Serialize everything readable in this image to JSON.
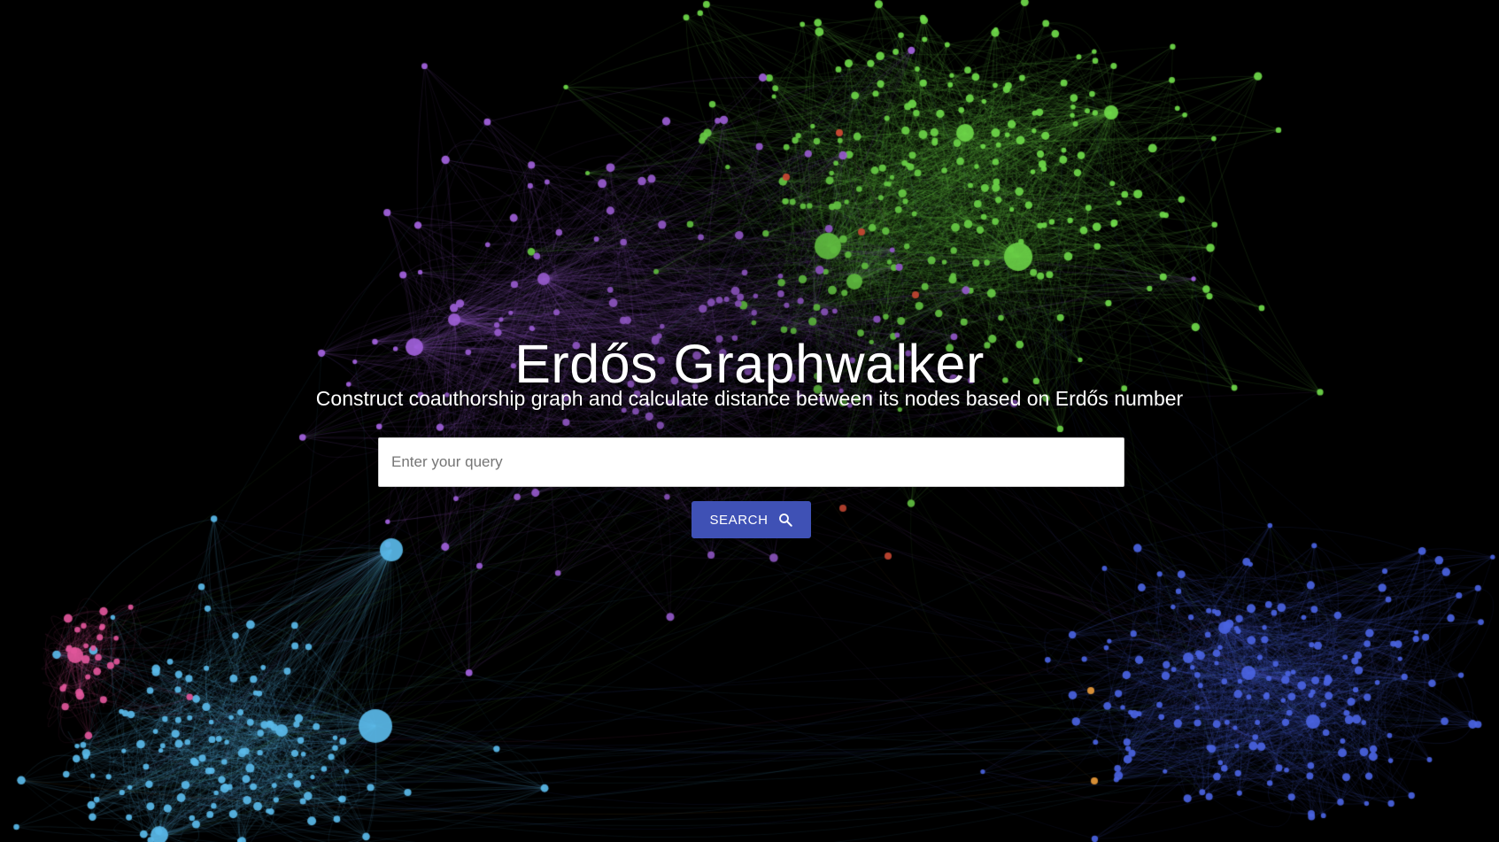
{
  "hero": {
    "title": "Erdős Graphwalker",
    "subtitle": "Construct coauthorship graph and calculate distance between its nodes based on Erdős number"
  },
  "search": {
    "placeholder": "Enter your query",
    "value": "",
    "button_label": "SEARCH",
    "button_icon": "search-icon"
  },
  "colors": {
    "background": "#000000",
    "button": "#3f51b5",
    "cluster_green": "#6fd94a",
    "cluster_purple": "#a463e0",
    "cluster_cyan": "#5ab8e8",
    "cluster_blue": "#4a63e0",
    "cluster_pink": "#e0569a",
    "accent_red": "#e0503a",
    "accent_orange": "#e89a3a"
  }
}
